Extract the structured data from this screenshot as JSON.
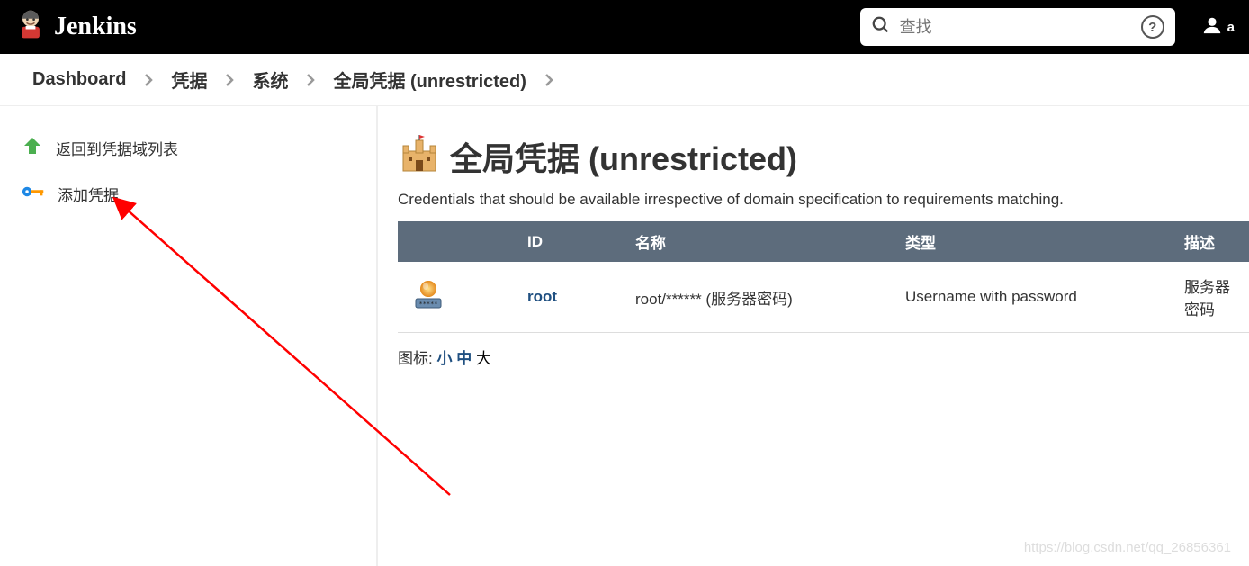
{
  "header": {
    "brand": "Jenkins",
    "search_placeholder": "查找",
    "user_label": "a"
  },
  "breadcrumb": {
    "items": [
      "Dashboard",
      "凭据",
      "系统",
      "全局凭据 (unrestricted)"
    ]
  },
  "sidebar": {
    "items": [
      {
        "label": "返回到凭据域列表"
      },
      {
        "label": "添加凭据"
      }
    ]
  },
  "main": {
    "title": "全局凭据 (unrestricted)",
    "description": "Credentials that should be available irrespective of domain specification to requirements matching.",
    "columns": {
      "icon": "",
      "id": "ID",
      "name": "名称",
      "type": "类型",
      "desc": "描述"
    },
    "rows": [
      {
        "id": "root",
        "name": "root/****** (服务器密码)",
        "type": "Username with password",
        "desc": "服务器密码"
      }
    ],
    "icon_size_label": "图标:",
    "icon_sizes": {
      "small": "小",
      "medium": "中",
      "large": "大"
    }
  },
  "watermark": "https://blog.csdn.net/qq_26856361"
}
